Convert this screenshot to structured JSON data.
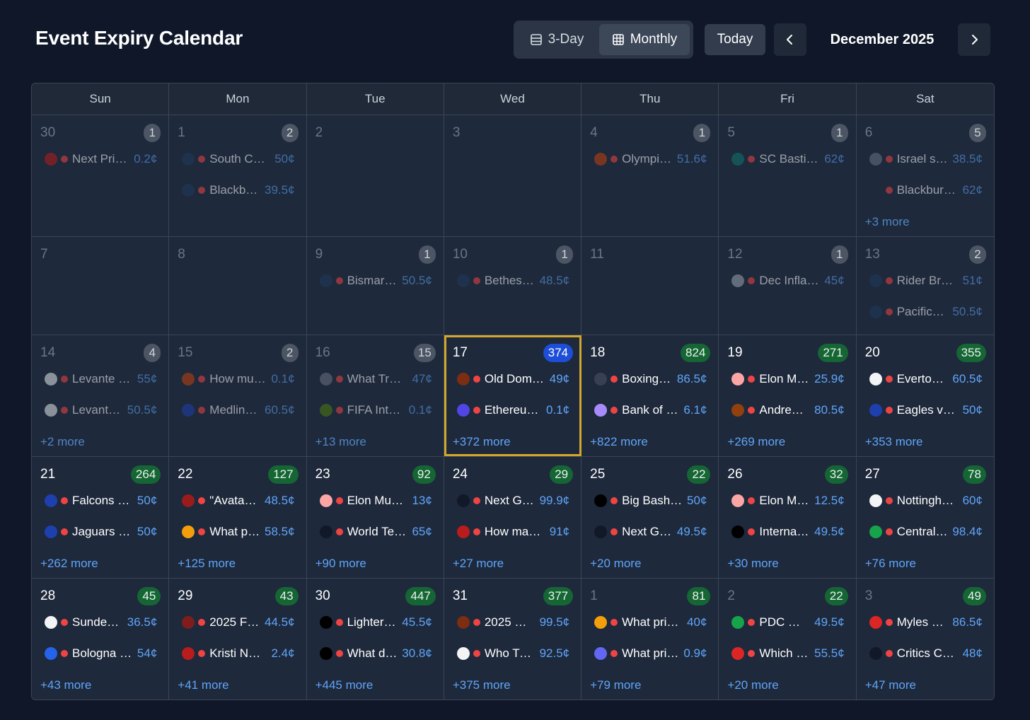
{
  "header": {
    "title": "Event Expiry Calendar",
    "view_3day": "3-Day",
    "view_monthly": "Monthly",
    "today": "Today",
    "month": "December 2025"
  },
  "colors": {
    "background": "#0f1729",
    "accent_blue": "#60a5fa",
    "today_outline": "#d4a72c",
    "badge_green": "#166534",
    "badge_blue": "#1d4ed8",
    "dot_red": "#ef4444"
  },
  "weekdays": [
    "Sun",
    "Mon",
    "Tue",
    "Wed",
    "Thu",
    "Fri",
    "Sat"
  ],
  "weeks": [
    [
      {
        "day": "30",
        "count": "1",
        "badge": "gray",
        "dim": true,
        "events": [
          {
            "icon": "#b91c1c",
            "name": "Next Pri…",
            "price": "0.2¢"
          }
        ],
        "more": ""
      },
      {
        "day": "1",
        "count": "2",
        "badge": "gray",
        "dim": true,
        "events": [
          {
            "icon": "#1e3a5f",
            "name": "South C…",
            "price": "50¢"
          },
          {
            "icon": "#1e3a5f",
            "name": "Blackb…",
            "price": "39.5¢"
          }
        ],
        "more": ""
      },
      {
        "day": "2",
        "count": "",
        "badge": "",
        "dim": true,
        "events": [],
        "more": ""
      },
      {
        "day": "3",
        "count": "",
        "badge": "",
        "dim": true,
        "events": [],
        "more": ""
      },
      {
        "day": "4",
        "count": "1",
        "badge": "gray",
        "dim": true,
        "events": [
          {
            "icon": "#c2410c",
            "name": "Olympi…",
            "price": "51.6¢"
          }
        ],
        "more": ""
      },
      {
        "day": "5",
        "count": "1",
        "badge": "gray",
        "dim": true,
        "events": [
          {
            "icon": "#0f766e",
            "name": "SC Basti…",
            "price": "62¢"
          }
        ],
        "more": ""
      },
      {
        "day": "6",
        "count": "5",
        "badge": "gray",
        "dim": true,
        "events": [
          {
            "icon": "#6b7280",
            "name": "Israel s…",
            "price": "38.5¢"
          },
          {
            "icon": "",
            "name": "Blackburn …",
            "price": "62¢"
          }
        ],
        "more": "+3 more"
      }
    ],
    [
      {
        "day": "7",
        "count": "",
        "badge": "",
        "dim": true,
        "events": [],
        "more": ""
      },
      {
        "day": "8",
        "count": "",
        "badge": "",
        "dim": true,
        "events": [],
        "more": ""
      },
      {
        "day": "9",
        "count": "1",
        "badge": "gray",
        "dim": true,
        "events": [
          {
            "icon": "#1e3a5f",
            "name": "Bismar…",
            "price": "50.5¢"
          }
        ],
        "more": ""
      },
      {
        "day": "10",
        "count": "1",
        "badge": "gray",
        "dim": true,
        "events": [
          {
            "icon": "#1e3a5f",
            "name": "Bethes…",
            "price": "48.5¢"
          }
        ],
        "more": ""
      },
      {
        "day": "11",
        "count": "",
        "badge": "",
        "dim": true,
        "events": [],
        "more": ""
      },
      {
        "day": "12",
        "count": "1",
        "badge": "gray",
        "dim": true,
        "events": [
          {
            "icon": "#9ca3af",
            "name": "Dec Infla…",
            "price": "45¢"
          }
        ],
        "more": ""
      },
      {
        "day": "13",
        "count": "2",
        "badge": "gray",
        "dim": true,
        "events": [
          {
            "icon": "#1e3a5f",
            "name": "Rider Bro…",
            "price": "51¢"
          },
          {
            "icon": "#1e3a5f",
            "name": "Pacific…",
            "price": "50.5¢"
          }
        ],
        "more": ""
      }
    ],
    [
      {
        "day": "14",
        "count": "4",
        "badge": "gray",
        "dim": true,
        "events": [
          {
            "icon": "#e5e7eb",
            "name": "Levante …",
            "price": "55¢"
          },
          {
            "icon": "#e5e7eb",
            "name": "Levant…",
            "price": "50.5¢"
          }
        ],
        "more": "+2 more"
      },
      {
        "day": "15",
        "count": "2",
        "badge": "gray",
        "dim": true,
        "events": [
          {
            "icon": "#c2410c",
            "name": "How mu…",
            "price": "0.1¢"
          },
          {
            "icon": "#1e40af",
            "name": "Medlin…",
            "price": "60.5¢"
          }
        ],
        "more": ""
      },
      {
        "day": "16",
        "count": "15",
        "badge": "gray",
        "dim": true,
        "events": [
          {
            "icon": "#6b7280",
            "name": "What Tru…",
            "price": "47¢"
          },
          {
            "icon": "#4d7c0f",
            "name": "FIFA Inte…",
            "price": "0.1¢"
          }
        ],
        "more": "+13 more"
      },
      {
        "day": "17",
        "count": "374",
        "badge": "blue",
        "dim": false,
        "today": true,
        "events": [
          {
            "icon": "#7c2d12",
            "name": "Old Domi…",
            "price": "49¢"
          },
          {
            "icon": "#4f46e5",
            "name": "Ethereu…",
            "price": "0.1¢"
          }
        ],
        "more": "+372 more"
      },
      {
        "day": "18",
        "count": "824",
        "badge": "green",
        "dim": false,
        "events": [
          {
            "icon": "#374151",
            "name": "Boxing…",
            "price": "86.5¢"
          },
          {
            "icon": "#a78bfa",
            "name": "Bank of …",
            "price": "6.1¢"
          }
        ],
        "more": "+822 more"
      },
      {
        "day": "19",
        "count": "271",
        "badge": "green",
        "dim": false,
        "events": [
          {
            "icon": "#fca5a5",
            "name": "Elon M…",
            "price": "25.9¢"
          },
          {
            "icon": "#92400e",
            "name": "Andre…",
            "price": "80.5¢"
          }
        ],
        "more": "+269 more"
      },
      {
        "day": "20",
        "count": "355",
        "badge": "green",
        "dim": false,
        "events": [
          {
            "icon": "#f3f4f6",
            "name": "Everto…",
            "price": "60.5¢"
          },
          {
            "icon": "#1e40af",
            "name": "Eagles v…",
            "price": "50¢"
          }
        ],
        "more": "+353 more"
      }
    ],
    [
      {
        "day": "21",
        "count": "264",
        "badge": "green",
        "dim": false,
        "events": [
          {
            "icon": "#1e40af",
            "name": "Falcons …",
            "price": "50¢"
          },
          {
            "icon": "#1e40af",
            "name": "Jaguars …",
            "price": "50¢"
          }
        ],
        "more": "+262 more"
      },
      {
        "day": "22",
        "count": "127",
        "badge": "green",
        "dim": false,
        "events": [
          {
            "icon": "#991b1b",
            "name": "\"Avatar…",
            "price": "48.5¢"
          },
          {
            "icon": "#f59e0b",
            "name": "What p…",
            "price": "58.5¢"
          }
        ],
        "more": "+125 more"
      },
      {
        "day": "23",
        "count": "92",
        "badge": "green",
        "dim": false,
        "events": [
          {
            "icon": "#fca5a5",
            "name": "Elon Mus…",
            "price": "13¢"
          },
          {
            "icon": "#111827",
            "name": "World Te…",
            "price": "65¢"
          }
        ],
        "more": "+90 more"
      },
      {
        "day": "24",
        "count": "29",
        "badge": "green",
        "dim": false,
        "events": [
          {
            "icon": "#111827",
            "name": "Next G…",
            "price": "99.9¢"
          },
          {
            "icon": "#b91c1c",
            "name": "How man…",
            "price": "91¢"
          }
        ],
        "more": "+27 more"
      },
      {
        "day": "25",
        "count": "22",
        "badge": "green",
        "dim": false,
        "events": [
          {
            "icon": "#000000",
            "name": "Big Bash…",
            "price": "50¢"
          },
          {
            "icon": "#111827",
            "name": "Next G…",
            "price": "49.5¢"
          }
        ],
        "more": "+20 more"
      },
      {
        "day": "26",
        "count": "32",
        "badge": "green",
        "dim": false,
        "events": [
          {
            "icon": "#fca5a5",
            "name": "Elon M…",
            "price": "12.5¢"
          },
          {
            "icon": "#000000",
            "name": "Interna…",
            "price": "49.5¢"
          }
        ],
        "more": "+30 more"
      },
      {
        "day": "27",
        "count": "78",
        "badge": "green",
        "dim": false,
        "events": [
          {
            "icon": "#f3f4f6",
            "name": "Nottingh…",
            "price": "60¢"
          },
          {
            "icon": "#16a34a",
            "name": "Central…",
            "price": "98.4¢"
          }
        ],
        "more": "+76 more"
      }
    ],
    [
      {
        "day": "28",
        "count": "45",
        "badge": "green",
        "dim": false,
        "events": [
          {
            "icon": "#f3f4f6",
            "name": "Sunder…",
            "price": "36.5¢"
          },
          {
            "icon": "#2563eb",
            "name": "Bologna …",
            "price": "54¢"
          }
        ],
        "more": "+43 more"
      },
      {
        "day": "29",
        "count": "43",
        "badge": "green",
        "dim": false,
        "events": [
          {
            "icon": "#7f1d1d",
            "name": "2025 F…",
            "price": "44.5¢"
          },
          {
            "icon": "#b91c1c",
            "name": "Kristi No…",
            "price": "2.4¢"
          }
        ],
        "more": "+41 more"
      },
      {
        "day": "30",
        "count": "447",
        "badge": "green",
        "dim": false,
        "events": [
          {
            "icon": "#000000",
            "name": "Lighter…",
            "price": "45.5¢"
          },
          {
            "icon": "#000000",
            "name": "What d…",
            "price": "30.8¢"
          }
        ],
        "more": "+445 more"
      },
      {
        "day": "31",
        "count": "377",
        "badge": "green",
        "dim": false,
        "events": [
          {
            "icon": "#7c2d12",
            "name": "2025 …",
            "price": "99.5¢"
          },
          {
            "icon": "#f3f4f6",
            "name": "Who Tr…",
            "price": "92.5¢"
          }
        ],
        "more": "+375 more"
      },
      {
        "day": "1",
        "count": "81",
        "badge": "green",
        "dim": false,
        "nonmonth": true,
        "events": [
          {
            "icon": "#f59e0b",
            "name": "What pri…",
            "price": "40¢"
          },
          {
            "icon": "#6366f1",
            "name": "What pri…",
            "price": "0.9¢"
          }
        ],
        "more": "+79 more"
      },
      {
        "day": "2",
        "count": "22",
        "badge": "green",
        "dim": false,
        "nonmonth": true,
        "events": [
          {
            "icon": "#16a34a",
            "name": "PDC W…",
            "price": "49.5¢"
          },
          {
            "icon": "#dc2626",
            "name": "Which …",
            "price": "55.5¢"
          }
        ],
        "more": "+20 more"
      },
      {
        "day": "3",
        "count": "49",
        "badge": "green",
        "dim": false,
        "nonmonth": true,
        "events": [
          {
            "icon": "#dc2626",
            "name": "Myles …",
            "price": "86.5¢"
          },
          {
            "icon": "#111827",
            "name": "Critics C…",
            "price": "48¢"
          }
        ],
        "more": "+47 more"
      }
    ]
  ]
}
